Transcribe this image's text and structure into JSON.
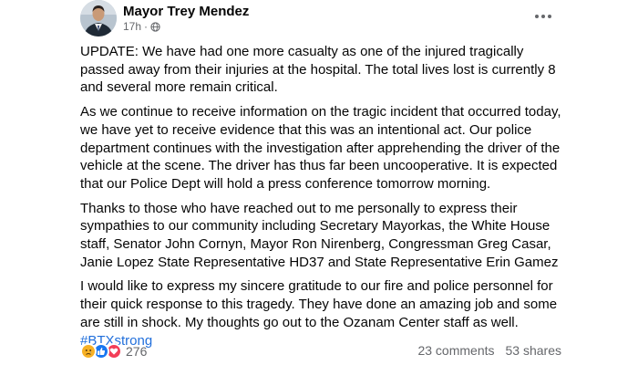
{
  "post": {
    "author": "Mayor Trey Mendez",
    "time": "17h",
    "visibility_icon": "globe-icon",
    "paragraphs": [
      "UPDATE:  We have had one more casualty as one of the injured tragically passed away from their injuries at the hospital.  The total lives lost is currently 8 and several more remain critical.",
      "As we continue to receive information on the tragic incident that occurred today, we have yet to receive evidence that this was an intentional act.  Our police department continues with the investigation after apprehending the driver of the vehicle at the scene.  The driver has thus far been uncooperative.  It is expected that our Police Dept will hold a press conference tomorrow morning.",
      "Thanks to those who have reached out to me personally to express their sympathies to our community including Secretary Mayorkas, the White House staff, Senator John Cornyn, Mayor Ron Nirenberg, Congressman Greg Casar, Janie Lopez State Representative HD37 and State Representative Erin Gamez",
      "I would like to express my sincere gratitude to our fire and police personnel for their quick response to this tragedy.  They have done an amazing job and some are still in shock.  My thoughts go out to the Ozanam Center staff as well."
    ],
    "hashtag": "#BTXstrong"
  },
  "footer": {
    "reaction_count": "276",
    "reaction_icons": [
      "sad-reaction-icon",
      "like-reaction-icon",
      "love-reaction-icon"
    ],
    "comments": "23 comments",
    "shares": "53 shares"
  },
  "colors": {
    "text": "#050505",
    "meta": "#65676b",
    "link": "#216fdb",
    "like": "#1877f2",
    "love": "#f33e58",
    "sad": "#f7b125"
  }
}
